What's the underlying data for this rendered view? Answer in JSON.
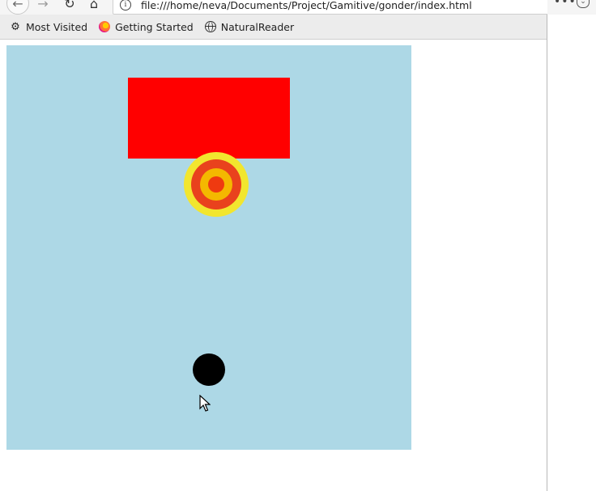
{
  "window": {
    "url": "file:///home/neva/Documents/Project/Gamitive/gonder/index.html"
  },
  "toolbar": {
    "back_icon": "back-arrow-icon",
    "forward_icon": "forward-arrow-icon",
    "reload_icon": "reload-icon",
    "home_icon": "home-icon",
    "info_icon": "info-icon",
    "more_label": "•••"
  },
  "bookmarks": {
    "items": [
      {
        "label": "Most Visited",
        "icon": "gear-icon"
      },
      {
        "label": "Getting Started",
        "icon": "firefox-icon"
      },
      {
        "label": "NaturalReader",
        "icon": "globe-icon"
      }
    ]
  },
  "game": {
    "background_color": "#add8e6",
    "block_color": "#ff0000",
    "target_colors": [
      "#f2e62e",
      "#e9421d",
      "#f4b800",
      "#ef3a10"
    ],
    "ball_color": "#000000"
  }
}
